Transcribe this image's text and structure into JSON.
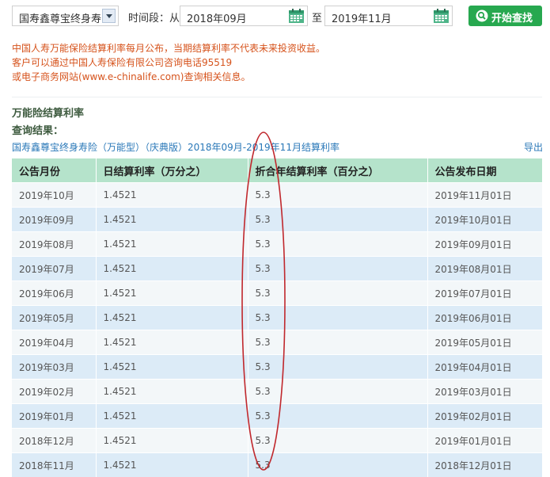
{
  "filters": {
    "product_value": "国寿鑫尊宝终身寿",
    "period_label": "时间段：从",
    "start_date": "2018年09月",
    "to_label": "至",
    "end_date": "2019年11月",
    "search_label": "开始查找"
  },
  "notice": [
    "中国人寿万能保险结算利率每月公布，当期结算利率不代表未来投资收益。",
    "客户可以通过中国人寿保险有限公司咨询电话95519",
    "或电子商务网站(www.e-chinalife.com)查询相关信息。"
  ],
  "section": {
    "title": "万能险结算利率",
    "result_label": "查询结果：",
    "caption": "国寿鑫尊宝终身寿险（万能型）（庆典版）2018年09月-2019年11月结算利率",
    "export_label": "导出"
  },
  "table": {
    "headers": [
      "公告月份",
      "日结算利率（万分之）",
      "折合年结算利率（百分之）",
      "公告发布日期"
    ],
    "rows": [
      [
        "2019年10月",
        "1.4521",
        "5.3",
        "2019年11月01日"
      ],
      [
        "2019年09月",
        "1.4521",
        "5.3",
        "2019年10月01日"
      ],
      [
        "2019年08月",
        "1.4521",
        "5.3",
        "2019年09月01日"
      ],
      [
        "2019年07月",
        "1.4521",
        "5.3",
        "2019年08月01日"
      ],
      [
        "2019年06月",
        "1.4521",
        "5.3",
        "2019年07月01日"
      ],
      [
        "2019年05月",
        "1.4521",
        "5.3",
        "2019年06月01日"
      ],
      [
        "2019年04月",
        "1.4521",
        "5.3",
        "2019年05月01日"
      ],
      [
        "2019年03月",
        "1.4521",
        "5.3",
        "2019年04月01日"
      ],
      [
        "2019年02月",
        "1.4521",
        "5.3",
        "2019年03月01日"
      ],
      [
        "2019年01月",
        "1.4521",
        "5.3",
        "2019年02月01日"
      ],
      [
        "2018年12月",
        "1.4521",
        "5.3",
        "2019年01月01日"
      ],
      [
        "2018年11月",
        "1.4521",
        "5.3",
        "2018年12月01日"
      ]
    ]
  },
  "colors": {
    "notice": "#d6531c",
    "header_bg": "#b5e3cb",
    "row_even": "#dcebf7",
    "row_odd": "#f3f7f9",
    "button": "#27a84f",
    "annotation": "#c0282d"
  },
  "icons": [
    "chevron-down-icon",
    "calendar-icon",
    "search-icon"
  ]
}
